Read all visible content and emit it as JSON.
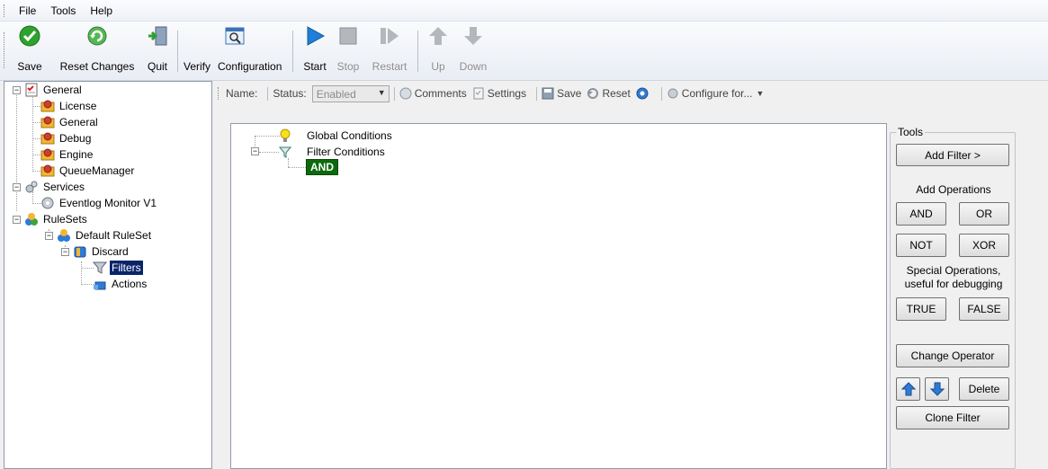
{
  "menu": {
    "items": [
      "File",
      "Tools",
      "Help"
    ]
  },
  "toolbar": {
    "save": "Save",
    "reset_changes": "Reset Changes",
    "quit": "Quit",
    "verify": "Verify",
    "configuration": "Configuration",
    "start": "Start",
    "stop": "Stop",
    "restart": "Restart",
    "up": "Up",
    "down": "Down"
  },
  "tree": {
    "general": "General",
    "license": "License",
    "general_child": "General",
    "debug": "Debug",
    "engine": "Engine",
    "queue_manager": "QueueManager",
    "services": "Services",
    "eventlog_monitor": "Eventlog Monitor V1",
    "rulesets": "RuleSets",
    "default_ruleset": "Default RuleSet",
    "discard": "Discard",
    "filters": "Filters",
    "actions": "Actions",
    "selected": "Filters"
  },
  "secondary_toolbar": {
    "name_label": "Name:",
    "status_label": "Status:",
    "status_value": "Enabled",
    "comments": "Comments",
    "settings": "Settings",
    "save": "Save",
    "reset": "Reset",
    "configure_for": "Configure for..."
  },
  "filter_tree": {
    "global_conditions": "Global Conditions",
    "filter_conditions": "Filter Conditions",
    "and_node": "AND"
  },
  "tools": {
    "legend": "Tools",
    "add_filter": "Add Filter >",
    "add_operations": "Add Operations",
    "and": "AND",
    "or": "OR",
    "not": "NOT",
    "xor": "XOR",
    "special_ops_line1": "Special Operations,",
    "special_ops_line2": "useful for debugging",
    "true": "TRUE",
    "false": "FALSE",
    "change_operator": "Change Operator",
    "delete": "Delete",
    "clone_filter": "Clone Filter"
  },
  "colors": {
    "selection": "#0a246a",
    "and_node_bg": "#0c6a0c",
    "start_blue": "#1f7fd9",
    "save_green": "#2ea12e"
  }
}
